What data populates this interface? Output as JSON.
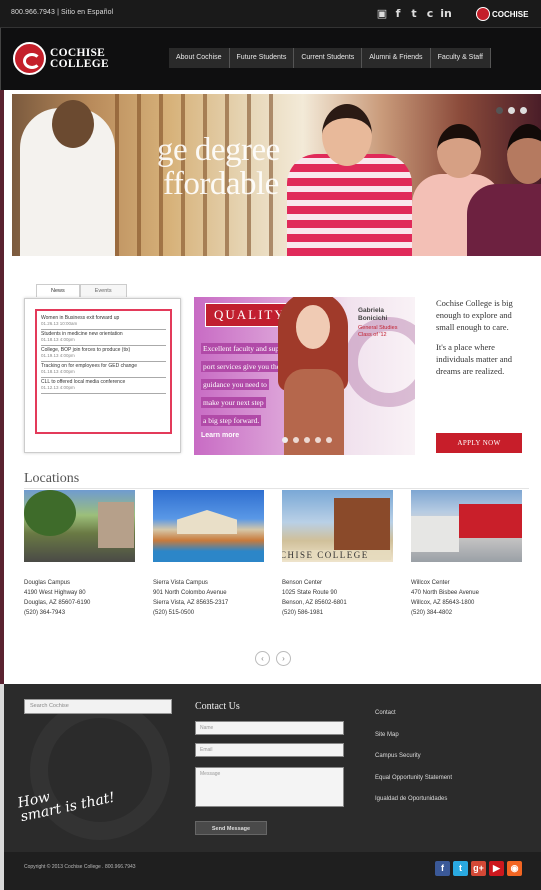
{
  "topbar": {
    "phone_spanish": "800.966.7943 | Sitio en Español",
    "social_icons": [
      "youtube-icon",
      "facebook-icon",
      "twitter-icon",
      "flickr-icon",
      "linkedin-icon"
    ],
    "mini_logo": "COCHISE"
  },
  "header": {
    "logo_line1": "COCHISE",
    "logo_line2": "COLLEGE",
    "nav": [
      "About Cochise",
      "Future Students",
      "Current Students",
      "Alumni & Friends",
      "Faculty & Staff"
    ]
  },
  "hero": {
    "tagline_line1": "ge degree",
    "tagline_line2": "ffordable",
    "slides": 3,
    "active_slide": 1
  },
  "news": {
    "tabs": [
      "News",
      "Events"
    ],
    "active_tab": 0,
    "items": [
      {
        "title": "Women in Business exit forward up",
        "date": "01.26.13 10:00am"
      },
      {
        "title": "Students in medicine new orientation",
        "date": "01.18.13 4:00pm"
      },
      {
        "title": "College, BOP join forces to produce (tix)",
        "date": "01.19.13 4:00pm"
      },
      {
        "title": "Tracking on for employees for GED change",
        "date": "01.18.13 4:00pm"
      },
      {
        "title": "CLL to offered local media conference",
        "date": "01.12.13 4:00pm"
      }
    ]
  },
  "quality": {
    "label": "QUALITY",
    "text_lines": [
      "Excellent faculty and sup-",
      "port services give you the",
      "guidance you need to",
      "make your next step",
      "a big step forward."
    ],
    "person_name": "Gabriela Bonicichi",
    "person_role": "General Studies Class of '12",
    "learn_more": "Learn more",
    "slides": 5,
    "active_slide": 0
  },
  "intro": {
    "p1": "Cochise College is big enough to explore and small enough to care.",
    "p2": "It's a place where individuals matter and dreams are realized.",
    "apply": "APPLY NOW"
  },
  "locations": {
    "title": "Locations",
    "campus_photo_word": "CHISE  COLLEGE",
    "items": [
      {
        "name": "Douglas Campus",
        "address": "4190 West Highway 80",
        "city": "Douglas, AZ 85607-6190",
        "phone": "(520) 364-7943"
      },
      {
        "name": "Sierra Vista Campus",
        "address": "901 North Colombo Avenue",
        "city": "Sierra Vista, AZ 85635-2317",
        "phone": "(520) 515-0500"
      },
      {
        "name": "Benson Center",
        "address": "1025 State Route 90",
        "city": "Benson, AZ 85602-6801",
        "phone": "(520) 586-1981"
      },
      {
        "name": "Willcox Center",
        "address": "470 North Bisbee Avenue",
        "city": "Willcox, AZ 85643-1800",
        "phone": "(520) 384-4802"
      }
    ],
    "pager_prev": "‹",
    "pager_next": "›"
  },
  "footer": {
    "search_placeholder": "Search Cochise",
    "contact_title": "Contact Us",
    "name_placeholder": "Name",
    "email_placeholder": "Email",
    "message_placeholder": "Message",
    "send": "Send Message",
    "links": [
      "Contact",
      "Site Map",
      "Campus Security",
      "Equal Opportunity Statement",
      "Igualdad de Oportunidades"
    ],
    "slogan_line1": "How",
    "slogan_line2": "smart is that!",
    "copyright": "Copyright © 2013 Cochise College . 800.966.7943",
    "social": [
      {
        "icon": "facebook-icon",
        "glyph": "f",
        "color": "#3b5998"
      },
      {
        "icon": "twitter-icon",
        "glyph": "t",
        "color": "#2aa9e0"
      },
      {
        "icon": "googleplus-icon",
        "glyph": "g+",
        "color": "#d34836"
      },
      {
        "icon": "youtube-icon",
        "glyph": "▶",
        "color": "#cc181e"
      },
      {
        "icon": "rss-icon",
        "glyph": "◉",
        "color": "#f26522"
      }
    ]
  }
}
